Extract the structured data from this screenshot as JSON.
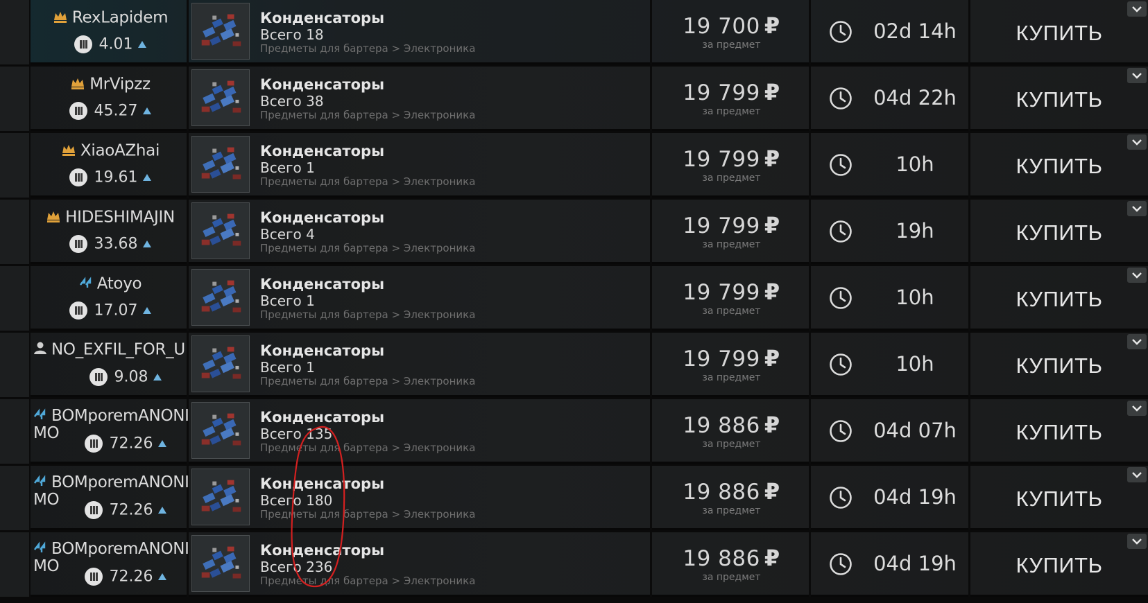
{
  "listings": [
    {
      "seller": "RexLapidem",
      "seller_icon": "crown-icon",
      "rating": "4.01",
      "item": "Конденсаторы",
      "count": "Всего 18",
      "category": "Предметы для бартера > Электроника",
      "price": "19 700",
      "currency": "₽",
      "per_item": "за предмет",
      "time": "02d 14h",
      "buy_label": "КУПИТЬ"
    },
    {
      "seller": "MrVipzz",
      "seller_icon": "crown-icon",
      "rating": "45.27",
      "item": "Конденсаторы",
      "count": "Всего 38",
      "category": "Предметы для бартера > Электроника",
      "price": "19 799",
      "currency": "₽",
      "per_item": "за предмет",
      "time": "04d 22h",
      "buy_label": "КУПИТЬ"
    },
    {
      "seller": "XiaoAZhai",
      "seller_icon": "crown-icon",
      "rating": "19.61",
      "item": "Конденсаторы",
      "count": "Всего 1",
      "category": "Предметы для бартера > Электроника",
      "price": "19 799",
      "currency": "₽",
      "per_item": "за предмет",
      "time": "10h",
      "buy_label": "КУПИТЬ"
    },
    {
      "seller": "HIDESHIMAJIN",
      "seller_icon": "crown-icon",
      "rating": "33.68",
      "item": "Конденсаторы",
      "count": "Всего 4",
      "category": "Предметы для бартера > Электроника",
      "price": "19 799",
      "currency": "₽",
      "per_item": "за предмет",
      "time": "19h",
      "buy_label": "КУПИТЬ"
    },
    {
      "seller": "Atoyo",
      "seller_icon": "bolt-icon",
      "rating": "17.07",
      "item": "Конденсаторы",
      "count": "Всего 1",
      "category": "Предметы для бартера > Электроника",
      "price": "19 799",
      "currency": "₽",
      "per_item": "за предмет",
      "time": "10h",
      "buy_label": "КУПИТЬ"
    },
    {
      "seller": "NO_EXFIL_FOR_U",
      "seller_icon": "user-icon",
      "rating": "9.08",
      "item": "Конденсаторы",
      "count": "Всего 1",
      "category": "Предметы для бартера > Электроника",
      "price": "19 799",
      "currency": "₽",
      "per_item": "за предмет",
      "time": "10h",
      "buy_label": "КУПИТЬ"
    },
    {
      "seller": "BOMporemANONIMO",
      "seller_icon": "bolt-icon",
      "rating": "72.26",
      "item": "Конденсаторы",
      "count": "Всего 135",
      "category": "Предметы для бартера > Электроника",
      "price": "19 886",
      "currency": "₽",
      "per_item": "за предмет",
      "time": "04d 07h",
      "buy_label": "КУПИТЬ"
    },
    {
      "seller": "BOMporemANONIMO",
      "seller_icon": "bolt-icon",
      "rating": "72.26",
      "item": "Конденсаторы",
      "count": "Всего 180",
      "category": "Предметы для бартера > Электроника",
      "price": "19 886",
      "currency": "₽",
      "per_item": "за предмет",
      "time": "04d 19h",
      "buy_label": "КУПИТЬ"
    },
    {
      "seller": "BOMporemANONIMO",
      "seller_icon": "bolt-icon",
      "rating": "72.26",
      "item": "Конденсаторы",
      "count": "Всего 236",
      "category": "Предметы для бартера > Электроника",
      "price": "19 886",
      "currency": "₽",
      "per_item": "за предмет",
      "time": "04d 19h",
      "buy_label": "КУПИТЬ"
    }
  ],
  "colors": {
    "crown": "#e0a13a",
    "bolt": "#4fa8d8",
    "rating_arrow": "#6fb4e0",
    "annotation": "#d42020"
  },
  "annotation_shape": "red-ellipse-highlight"
}
